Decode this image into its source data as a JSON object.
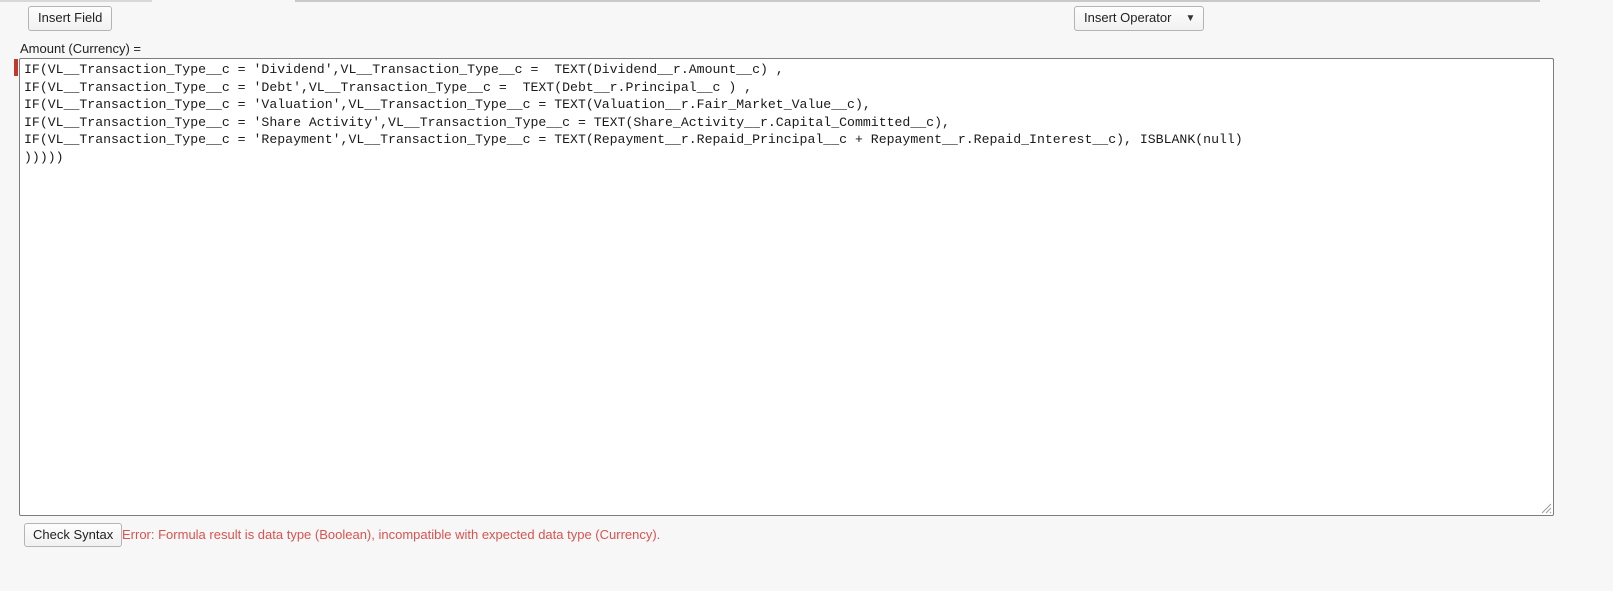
{
  "toolbar": {
    "insert_field_label": "Insert Field",
    "insert_operator_label": "Insert Operator",
    "insert_operator_caret": "▼"
  },
  "formula": {
    "label": "Amount (Currency) =",
    "text": "IF(VL__Transaction_Type__c = 'Dividend',VL__Transaction_Type__c =  TEXT(Dividend__r.Amount__c) ,\nIF(VL__Transaction_Type__c = 'Debt',VL__Transaction_Type__c =  TEXT(Debt__r.Principal__c ) ,\nIF(VL__Transaction_Type__c = 'Valuation',VL__Transaction_Type__c = TEXT(Valuation__r.Fair_Market_Value__c),\nIF(VL__Transaction_Type__c = 'Share Activity',VL__Transaction_Type__c = TEXT(Share_Activity__r.Capital_Committed__c),\nIF(VL__Transaction_Type__c = 'Repayment',VL__Transaction_Type__c = TEXT(Repayment__r.Repaid_Principal__c + Repayment__r.Repaid_Interest__c), ISBLANK(null)\n)))))"
  },
  "footer": {
    "check_syntax_label": "Check Syntax",
    "error_message": "Error: Formula result is data type (Boolean), incompatible with expected data type (Currency)."
  },
  "colors": {
    "error_text": "#d9534f",
    "error_marker": "#c0392b",
    "page_background": "#f7f7f7",
    "editor_background": "#ffffff"
  }
}
